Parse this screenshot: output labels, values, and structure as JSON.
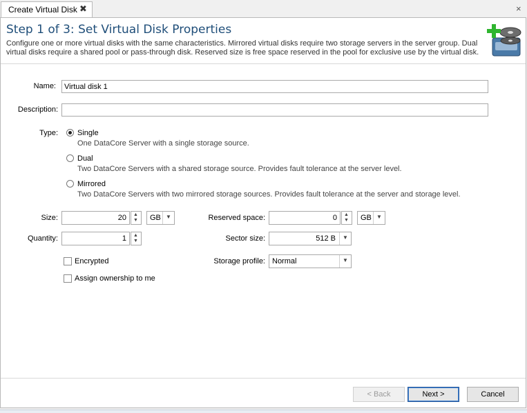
{
  "tab": {
    "label": "Create Virtual Disk",
    "close_glyph": "✖"
  },
  "window": {
    "close_glyph": "×"
  },
  "header": {
    "title": "Step 1 of 3: Set Virtual Disk Properties",
    "description": "Configure one or more virtual disks with the same characteristics. Mirrored virtual disks require two storage servers in the server group. Dual virtual disks require a shared pool or pass-through disk.  Reserved size is free space reserved in the pool for exclusive use by the virtual disk.",
    "icon": "add-virtual-disk-icon"
  },
  "form": {
    "name_label": "Name:",
    "name_value": "Virtual disk 1",
    "description_label": "Description:",
    "description_value": "",
    "type_label": "Type:",
    "types": [
      {
        "title": "Single",
        "desc": "One DataCore Server with a single storage source.",
        "selected": true
      },
      {
        "title": "Dual",
        "desc": "Two DataCore Servers with a shared storage source. Provides fault tolerance at the server level.",
        "selected": false
      },
      {
        "title": "Mirrored",
        "desc": "Two DataCore Servers with two mirrored storage sources. Provides fault tolerance at the server and storage level.",
        "selected": false
      }
    ],
    "size_label": "Size:",
    "size_value": "20",
    "size_unit": "GB",
    "reserved_label": "Reserved space:",
    "reserved_value": "0",
    "reserved_unit": "GB",
    "quantity_label": "Quantity:",
    "quantity_value": "1",
    "sector_label": "Sector size:",
    "sector_value": "512 B",
    "encrypted_label": "Encrypted",
    "encrypted_checked": false,
    "ownership_label": "Assign ownership to me",
    "ownership_checked": false,
    "profile_label": "Storage profile:",
    "profile_value": "Normal"
  },
  "footer": {
    "back_label": "< Back",
    "next_label": "Next >",
    "cancel_label": "Cancel"
  },
  "colors": {
    "title": "#1f4e79",
    "accent_green": "#2fb52f"
  }
}
